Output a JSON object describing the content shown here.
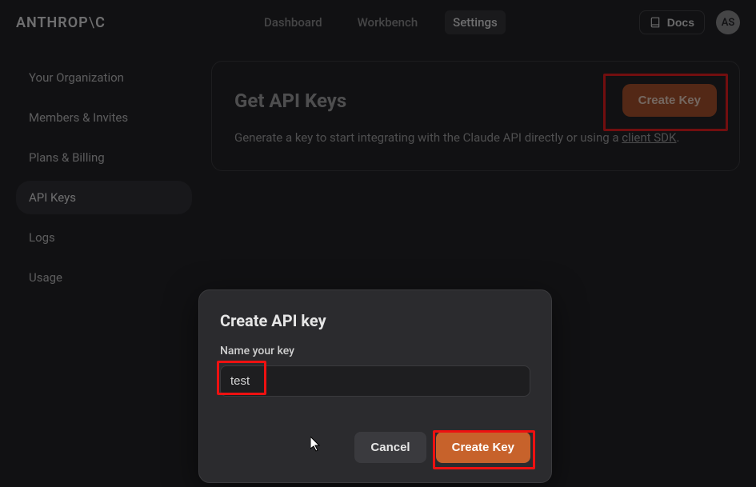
{
  "brand_left": "ANTHROP",
  "brand_slash": "\\",
  "brand_right": "C",
  "topnav": {
    "dashboard": "Dashboard",
    "workbench": "Workbench",
    "settings": "Settings"
  },
  "docs_label": "Docs",
  "avatar_initials": "AS",
  "sidebar": {
    "org": "Your Organization",
    "members": "Members & Invites",
    "plans": "Plans & Billing",
    "apikeys": "API Keys",
    "logs": "Logs",
    "usage": "Usage"
  },
  "panel": {
    "title": "Get API Keys",
    "subtitle_pre": "Generate a key to start integrating with the Claude API directly or using a ",
    "subtitle_link": "client SDK",
    "subtitle_post": ".",
    "create_btn": "Create Key"
  },
  "modal": {
    "title": "Create API key",
    "label": "Name your key",
    "input_value": "test",
    "cancel": "Cancel",
    "create": "Create Key"
  }
}
